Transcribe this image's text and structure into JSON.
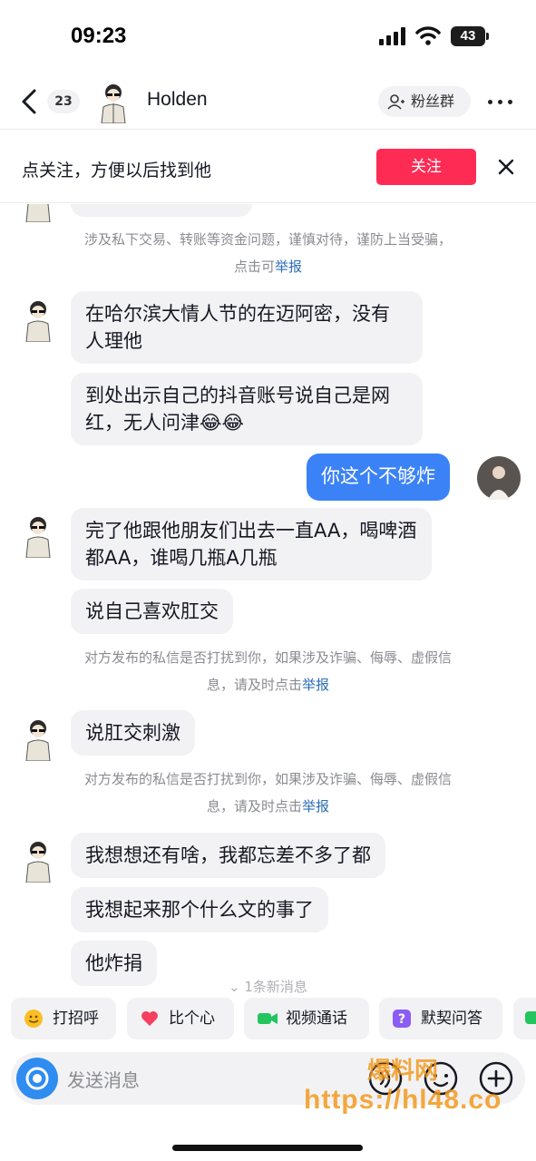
{
  "status_bar": {
    "time": "09:23",
    "battery": "43"
  },
  "header": {
    "back_label": "back",
    "unread_count": "23",
    "contact_name": "Holden",
    "fan_group_label": "粉丝群"
  },
  "follow_banner": {
    "text": "点关注，方便以后找到他",
    "button_label": "关注"
  },
  "notices": {
    "first_line1": "涉及私下交易、转账等资金问题，谨慎对待，谨防上当受骗，",
    "first_line2_prefix": "点击可",
    "report_label": "举报",
    "privacy_line1": "对方发布的私信是否打扰到你，如果涉及诈骗、侮辱、虚假信",
    "privacy_line2_prefix": "息，请及时点击"
  },
  "messages": [
    {
      "from": "contact",
      "text": "在哈尔滨大情人节的在迈阿密，没有人理他"
    },
    {
      "from": "contact",
      "text": "到处出示自己的抖音账号说自己是网红，无人问津😂😂"
    },
    {
      "from": "me",
      "text": "你这个不够炸"
    },
    {
      "from": "contact",
      "text": "完了他跟他朋友们出去一直AA，喝啤酒都AA，谁喝几瓶A几瓶"
    },
    {
      "from": "contact",
      "text": "说自己喜欢肛交"
    },
    {
      "from": "contact",
      "text": "说肛交刺激"
    },
    {
      "from": "contact",
      "text": "我想想还有啥，我都忘差不多了都"
    },
    {
      "from": "contact",
      "text": "我想起来那个什么文的事了"
    },
    {
      "from": "contact",
      "text": "他炸捐"
    }
  ],
  "new_messages_hint": "1条新消息",
  "quick_replies": [
    {
      "label": "打招呼",
      "icon": "wave-emoji-icon"
    },
    {
      "label": "比个心",
      "icon": "heart-icon"
    },
    {
      "label": "视频通话",
      "icon": "video-call-icon"
    },
    {
      "label": "默契问答",
      "icon": "quiz-icon"
    }
  ],
  "input": {
    "placeholder": "发送消息"
  },
  "watermark": {
    "top": "爆料网",
    "url": "https://hl48.co"
  },
  "colors": {
    "follow_button": "#fe2c55",
    "sent_bubble": "#3b82f6",
    "received_bubble": "#f2f2f4",
    "report_link": "#2b6db5"
  }
}
